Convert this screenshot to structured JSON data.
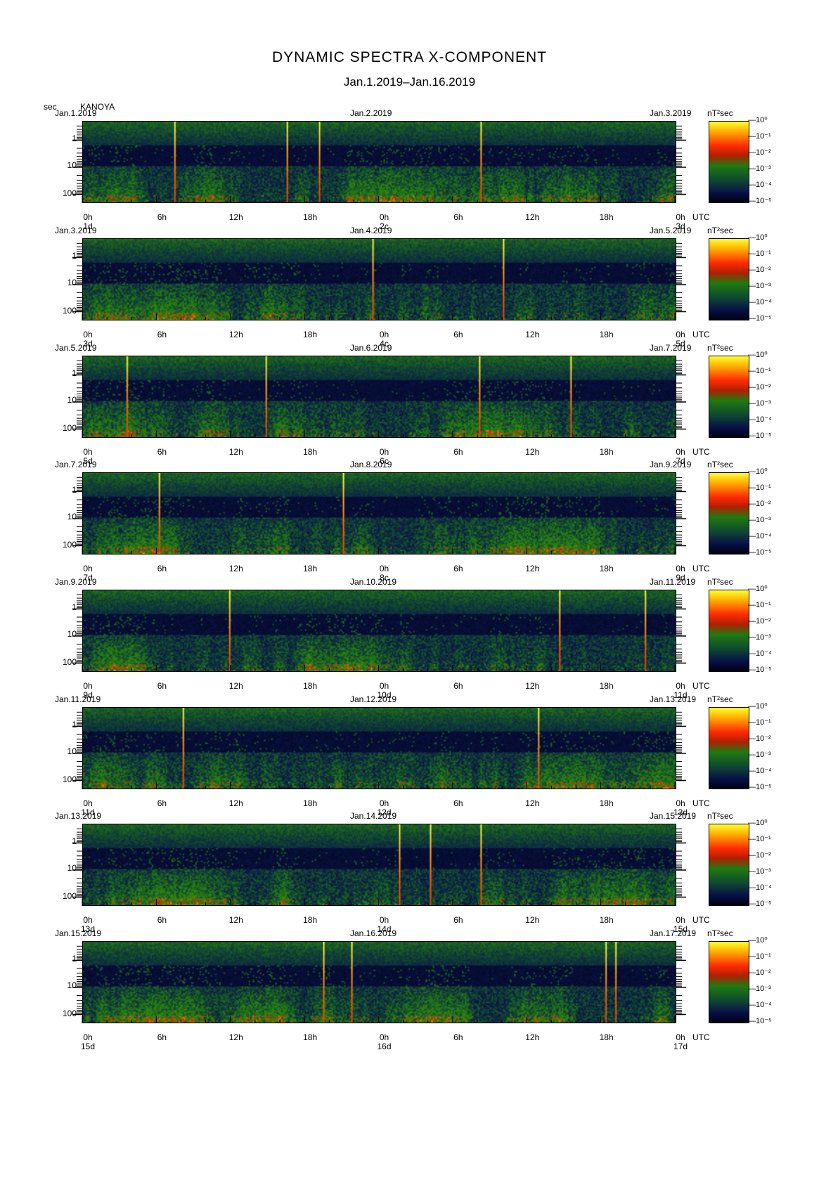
{
  "title": "DYNAMIC SPECTRA X-COMPONENT",
  "subtitle": "Jan.1.2019–Jan.16.2019",
  "ylabel": "sec",
  "station": "KANOYA",
  "colorbar_unit": "nT²sec",
  "x_tick_labels": [
    "0h",
    "6h",
    "12h",
    "18h",
    "0h",
    "6h",
    "12h",
    "18h",
    "0h"
  ],
  "utc_label": "UTC",
  "y_tick_labels": [
    "1",
    "10",
    "100"
  ],
  "colorbar_ticks": [
    "10⁰",
    "10⁻¹",
    "10⁻²",
    "10⁻³",
    "10⁻⁴",
    "10⁻⁵"
  ],
  "chart_data": {
    "type": "heatmap",
    "title": "DYNAMIC SPECTRA X-COMPONENT",
    "subtitle": "Jan.1.2019–Jan.16.2019",
    "ylabel": "sec",
    "y_scale": "log",
    "ylim": [
      500,
      0.2
    ],
    "colorbar": {
      "label": "nT²sec",
      "scale": "log",
      "range": [
        1e-05,
        1
      ]
    },
    "panels": [
      {
        "date_left": "Jan.1.2019",
        "date_mid": "Jan.2.2019",
        "date_right": "Jan.3.2019",
        "day_left": "1d",
        "day_mid": "2c",
        "day_right": "3d"
      },
      {
        "date_left": "Jan.3.2019",
        "date_mid": "Jan.4.2019",
        "date_right": "Jan.5.2019",
        "day_left": "3d",
        "day_mid": "4c",
        "day_right": "5d"
      },
      {
        "date_left": "Jan.5.2019",
        "date_mid": "Jan.6.2019",
        "date_right": "Jan.7.2019",
        "day_left": "5d",
        "day_mid": "6c",
        "day_right": "7d"
      },
      {
        "date_left": "Jan.7.2019",
        "date_mid": "Jan.8.2019",
        "date_right": "Jan.9.2019",
        "day_left": "7d",
        "day_mid": "8c",
        "day_right": "9d"
      },
      {
        "date_left": "Jan.9.2019",
        "date_mid": "Jan.10.2019",
        "date_right": "Jan.11.2019",
        "day_left": "9d",
        "day_mid": "10d",
        "day_right": "11d"
      },
      {
        "date_left": "Jan.11.2019",
        "date_mid": "Jan.12.2019",
        "date_right": "Jan.13.2019",
        "day_left": "11d",
        "day_mid": "12d",
        "day_right": "13d"
      },
      {
        "date_left": "Jan.13.2019",
        "date_mid": "Jan.14.2019",
        "date_right": "Jan.15.2019",
        "day_left": "13d",
        "day_mid": "14d",
        "day_right": "15d"
      },
      {
        "date_left": "Jan.15.2019",
        "date_mid": "Jan.16.2019",
        "date_right": "Jan.17.2019",
        "day_left": "15d",
        "day_mid": "16d",
        "day_right": "17d"
      }
    ]
  }
}
